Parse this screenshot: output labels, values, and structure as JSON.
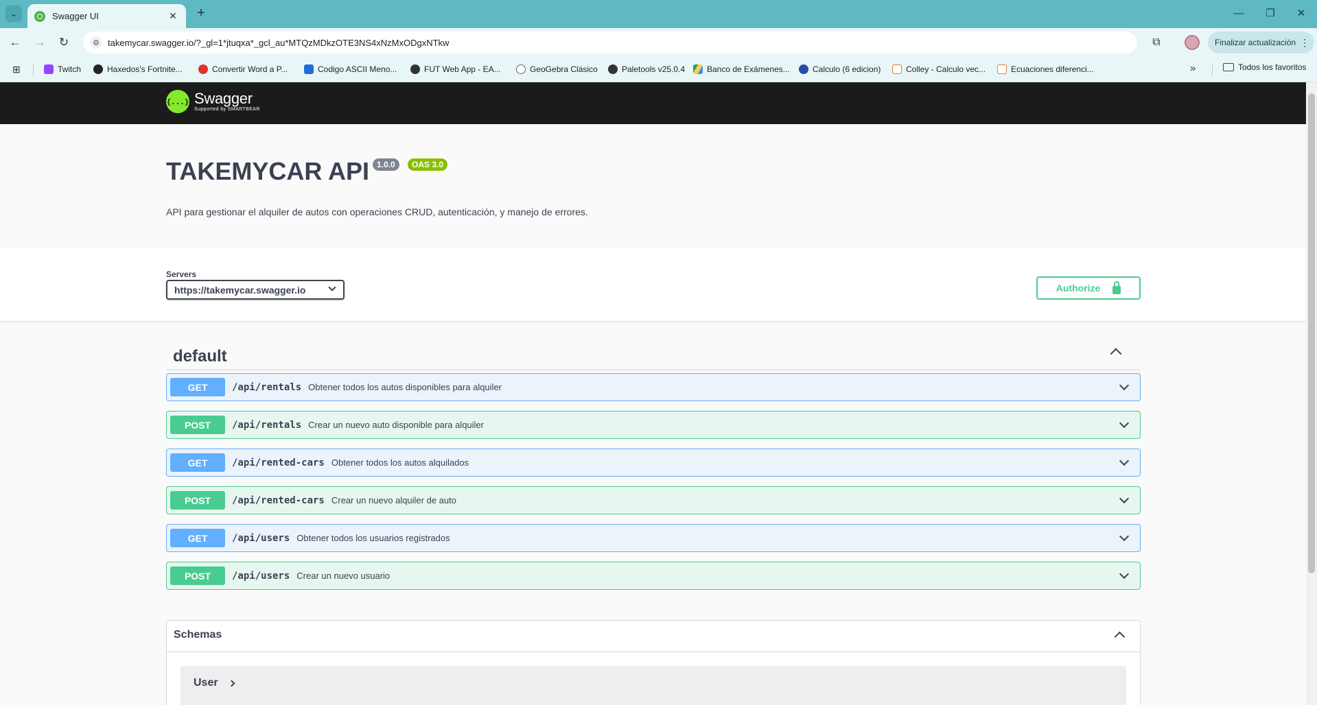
{
  "browser": {
    "tab": {
      "title": "Swagger UI",
      "close_glyph": "✕"
    },
    "new_tab_glyph": "+",
    "window_controls": {
      "minimize": "—",
      "restore": "❐",
      "close": "✕"
    },
    "nav": {
      "back": "←",
      "forward": "→",
      "reload": "↻"
    },
    "url": "takemycar.swagger.io/?_gl=1*jtuqxa*_gcl_au*MTQzMDkzOTE3NS4xNzMxODgxNTkw",
    "update_button": "Finalizar actualización",
    "bookmarks": [
      {
        "label": "Twitch",
        "color": "#9146ff"
      },
      {
        "label": "Haxedos's Fortnite...",
        "color": "#222222"
      },
      {
        "label": "Convertir Word a P...",
        "color": "#e0342c"
      },
      {
        "label": "Codigo ASCII Meno...",
        "color": "#1e6fd9"
      },
      {
        "label": "FUT Web App - EA...",
        "color": "#333333"
      },
      {
        "label": "GeoGebra Clásico",
        "color": "#666666"
      },
      {
        "label": "Paletools v25.0.4",
        "color": "#333333"
      },
      {
        "label": "Banco de Exámenes...",
        "color": "#1fa463"
      },
      {
        "label": "Calculo (6 edicion)",
        "color": "#2d4aa6"
      },
      {
        "label": "Colley - Calculo vec...",
        "color": "#e07b2c"
      },
      {
        "label": "Ecuaciones diferenci...",
        "color": "#e07b2c"
      }
    ],
    "more_bookmarks": "»",
    "all_bookmarks": "Todos los favoritos"
  },
  "swagger": {
    "logo": {
      "name": "Swagger",
      "sub": "Supported by SMARTBEAR",
      "mark": "{...}"
    },
    "title": "TAKEMYCAR API",
    "version": "1.0.0",
    "oas": "OAS 3.0",
    "description": "API para gestionar el alquiler de autos con operaciones CRUD, autenticación, y manejo de errores.",
    "servers": {
      "label": "Servers",
      "selected": "https://takemycar.swagger.io"
    },
    "authorize": "Authorize",
    "tag": "default",
    "operations": [
      {
        "method": "GET",
        "path": "/api/rentals",
        "summary": "Obtener todos los autos disponibles para alquiler"
      },
      {
        "method": "POST",
        "path": "/api/rentals",
        "summary": "Crear un nuevo auto disponible para alquiler"
      },
      {
        "method": "GET",
        "path": "/api/rented-cars",
        "summary": "Obtener todos los autos alquilados"
      },
      {
        "method": "POST",
        "path": "/api/rented-cars",
        "summary": "Crear un nuevo alquiler de auto"
      },
      {
        "method": "GET",
        "path": "/api/users",
        "summary": "Obtener todos los usuarios registrados"
      },
      {
        "method": "POST",
        "path": "/api/users",
        "summary": "Crear un nuevo usuario"
      }
    ],
    "schemas": {
      "title": "Schemas",
      "items": [
        "User"
      ]
    }
  }
}
